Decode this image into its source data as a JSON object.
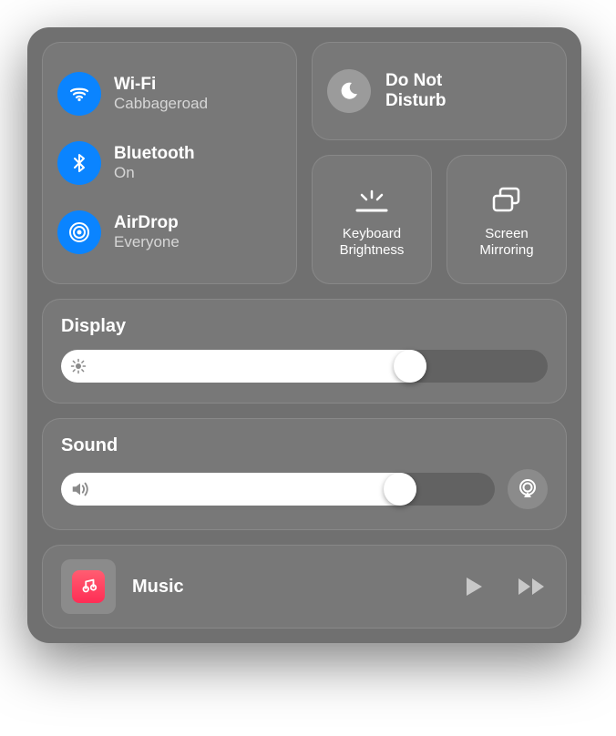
{
  "network": {
    "wifi": {
      "title": "Wi-Fi",
      "subtitle": "Cabbageroad"
    },
    "bluetooth": {
      "title": "Bluetooth",
      "subtitle": "On"
    },
    "airdrop": {
      "title": "AirDrop",
      "subtitle": "Everyone"
    }
  },
  "dnd": {
    "line1": "Do Not",
    "line2": "Disturb"
  },
  "keyboard_brightness": {
    "label": "Keyboard\nBrightness"
  },
  "screen_mirroring": {
    "label": "Screen\nMirroring"
  },
  "display": {
    "title": "Display",
    "value_pct": 75
  },
  "sound": {
    "title": "Sound",
    "value_pct": 82
  },
  "music": {
    "app": "Music"
  }
}
